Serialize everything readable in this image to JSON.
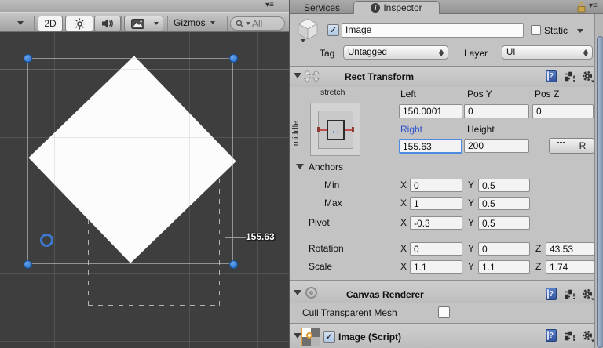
{
  "scene": {
    "pane_menu_glyph": "▾≡",
    "toolbar": {
      "btn_2d": "2D",
      "gizmos_label": "Gizmos",
      "search_text": "All"
    },
    "measurement_label": "155.63"
  },
  "inspector": {
    "tab_services": "Services",
    "tab_inspector": "Inspector",
    "info_glyph": "i",
    "help_glyph": "?",
    "check_glyph": "✓",
    "axis": {
      "x": "X",
      "y": "Y",
      "z": "Z"
    },
    "header": {
      "name_value": "Image",
      "static_label": "Static",
      "tag_label": "Tag",
      "tag_value": "Untagged",
      "layer_label": "Layer",
      "layer_value": "UI"
    },
    "rect_transform": {
      "title": "Rect Transform",
      "stretch_label": "stretch",
      "middle_label": "middle",
      "arrow_glyph": "↔",
      "left_label": "Left",
      "left_value": "150.0001",
      "posy_label": "Pos Y",
      "posy_value": "0",
      "posz_label": "Pos Z",
      "posz_value": "0",
      "right_label": "Right",
      "right_value": "155.63",
      "height_label": "Height",
      "height_value": "200",
      "r_button_label": "R",
      "anchors_label": "Anchors",
      "min_label": "Min",
      "min_x": "0",
      "min_y": "0.5",
      "max_label": "Max",
      "max_x": "1",
      "max_y": "0.5",
      "pivot_label": "Pivot",
      "pivot_x": "-0.3",
      "pivot_y": "0.5",
      "rotation_label": "Rotation",
      "rotation_x": "0",
      "rotation_y": "0",
      "rotation_z": "43.53",
      "scale_label": "Scale",
      "scale_x": "1.1",
      "scale_y": "1.1",
      "scale_z": "1.74"
    },
    "canvas_renderer": {
      "title": "Canvas Renderer",
      "cull_label": "Cull Transparent Mesh"
    },
    "image_script": {
      "title": "Image (Script)"
    }
  }
}
